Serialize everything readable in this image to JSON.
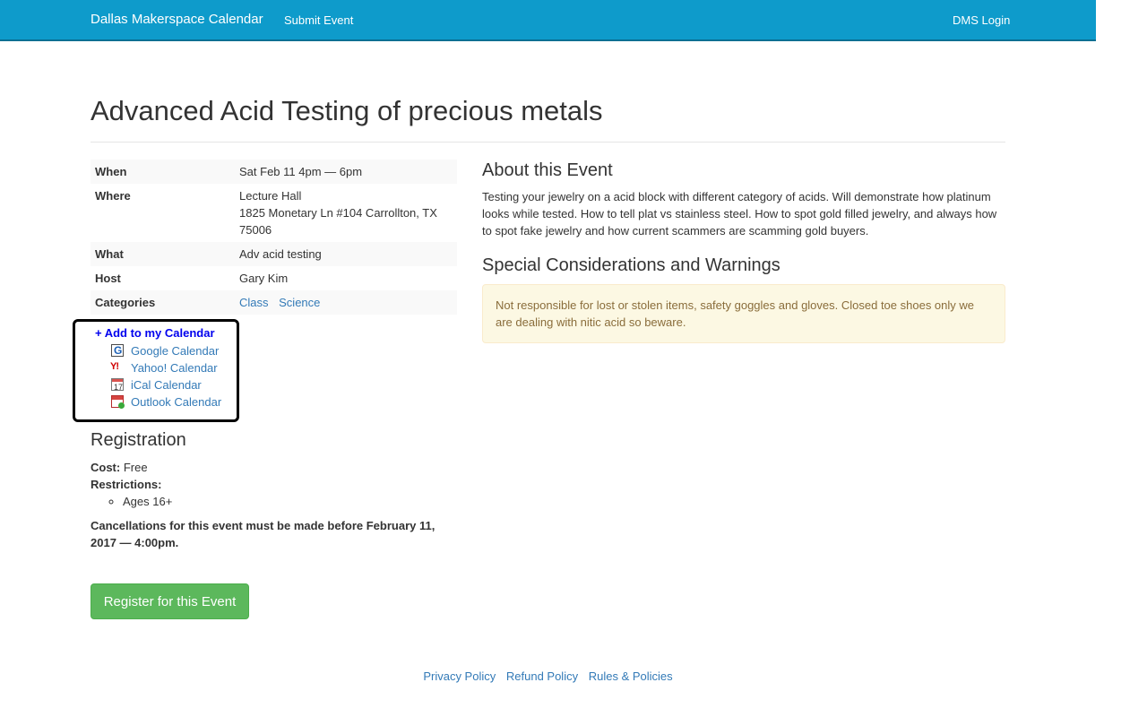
{
  "navbar": {
    "brand": "Dallas Makerspace Calendar",
    "submit_event": "Submit Event",
    "login": "DMS Login"
  },
  "event": {
    "title": "Advanced Acid Testing of precious metals",
    "details": {
      "when_label": "When",
      "when_value": "Sat Feb 11 4pm — 6pm",
      "where_label": "Where",
      "where_line1": "Lecture Hall",
      "where_line2": "1825 Monetary Ln #104 Carrollton, TX 75006",
      "what_label": "What",
      "what_value": "Adv acid testing",
      "host_label": "Host",
      "host_value": "Gary Kim",
      "categories_label": "Categories",
      "categories": [
        "Class",
        "Science"
      ]
    },
    "add_calendar": {
      "heading": "+ Add to my Calendar",
      "options": [
        {
          "label": "Google Calendar",
          "icon": "google-calendar-icon"
        },
        {
          "label": "Yahoo! Calendar",
          "icon": "yahoo-calendar-icon"
        },
        {
          "label": "iCal Calendar",
          "icon": "ical-calendar-icon"
        },
        {
          "label": "Outlook Calendar",
          "icon": "outlook-calendar-icon"
        }
      ]
    },
    "registration": {
      "title": "Registration",
      "cost_label": "Cost:",
      "cost_value": "Free",
      "restrictions_label": "Restrictions:",
      "restrictions": [
        "Ages 16+"
      ],
      "cancellation": "Cancellations for this event must be made before February 11, 2017 — 4:00pm.",
      "register_button": "Register for this Event"
    },
    "about": {
      "title": "About this Event",
      "text": "Testing your jewelry on a acid block with different category of acids. Will demonstrate how platinum looks while tested. How to tell plat vs stainless steel. How to spot gold filled jewelry, and always how to spot fake jewelry and how current scammers are scamming gold buyers."
    },
    "warnings": {
      "title": "Special Considerations and Warnings",
      "text": "Not responsible for lost or stolen items, safety goggles and gloves. Closed toe shoes only we are dealing with nitic acid so beware."
    }
  },
  "footer": {
    "links": [
      "Privacy Policy",
      "Refund Policy",
      "Rules & Policies"
    ]
  },
  "colors": {
    "navbar": "#0e9bcb",
    "link": "#337ab7",
    "register_button": "#5cb85c",
    "warning_bg": "#fcf8e3",
    "warning_text": "#8a6d3b"
  }
}
